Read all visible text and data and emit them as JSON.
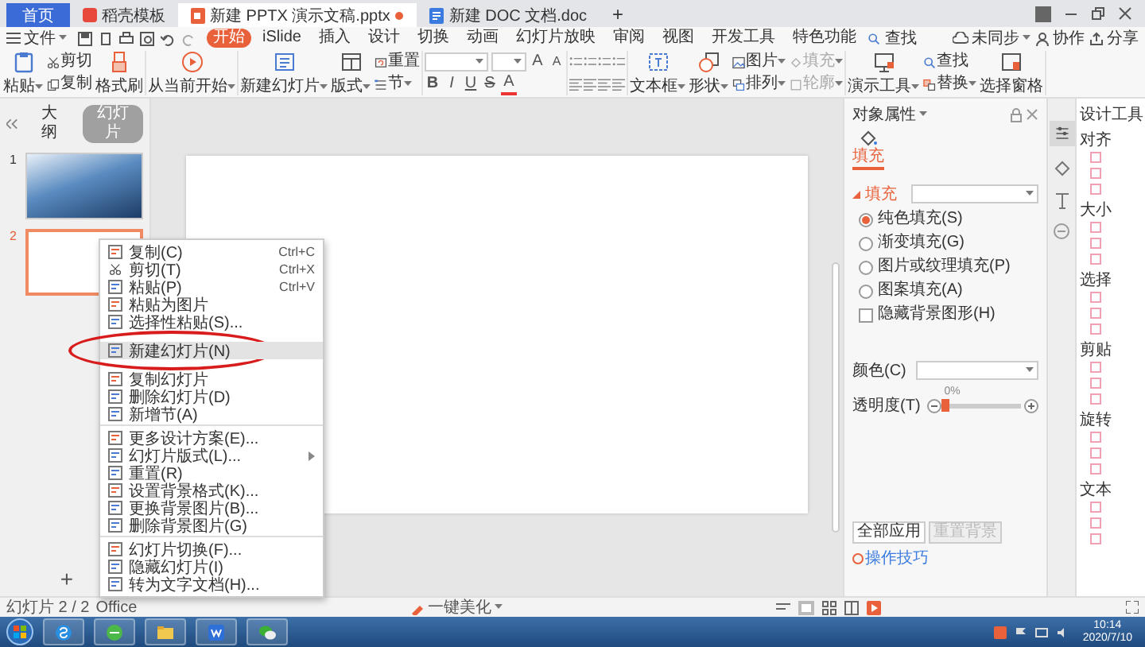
{
  "title_tabs": [
    {
      "label": "首页",
      "kind": "home",
      "selected": false
    },
    {
      "label": "稻壳模板",
      "kind": "docer",
      "selected": false
    },
    {
      "label": "新建 PPTX 演示文稿.pptx",
      "kind": "pptx",
      "selected": true
    },
    {
      "label": "新建 DOC 文档.doc",
      "kind": "doc",
      "selected": false
    }
  ],
  "new_tab": "+",
  "menu": {
    "file": "文件",
    "tabs": [
      {
        "label": "开始",
        "selected": true
      },
      {
        "label": "iSlide",
        "selected": false
      },
      {
        "label": "插入",
        "selected": false
      },
      {
        "label": "设计",
        "selected": false
      },
      {
        "label": "切换",
        "selected": false
      },
      {
        "label": "动画",
        "selected": false
      },
      {
        "label": "幻灯片放映",
        "selected": false
      },
      {
        "label": "审阅",
        "selected": false
      },
      {
        "label": "视图",
        "selected": false
      },
      {
        "label": "开发工具",
        "selected": false
      },
      {
        "label": "特色功能",
        "selected": false
      }
    ],
    "search": "查找",
    "sync": "未同步",
    "collab": "协作",
    "share": "分享"
  },
  "ribbon": {
    "groups": [
      {
        "items": [
          {
            "kind": "big",
            "label": "粘贴",
            "dropdown": true
          },
          {
            "kind": "stack",
            "buttons": [
              {
                "label": "剪切",
                "dropdown": false,
                "disabled": false
              },
              {
                "label": "复制",
                "dropdown": false,
                "disabled": false
              }
            ]
          },
          {
            "kind": "big",
            "label": "格式刷",
            "dropdown": false
          }
        ]
      },
      {
        "items": [
          {
            "kind": "big",
            "label": "从当前开始",
            "dropdown": true
          }
        ]
      },
      {
        "items": [
          {
            "kind": "big",
            "label": "新建幻灯片",
            "dropdown": true
          },
          {
            "kind": "big",
            "label": "版式",
            "dropdown": true
          },
          {
            "kind": "stack",
            "buttons": [
              {
                "label": "重置",
                "dropdown": false,
                "disabled": false
              },
              {
                "label": "节",
                "dropdown": true,
                "disabled": false
              }
            ]
          }
        ]
      },
      {
        "items": [
          {
            "kind": "font",
            "format": [
              "B",
              "I",
              "U",
              "S",
              "A"
            ],
            "sizes": [
              "A",
              "A"
            ]
          }
        ]
      },
      {
        "items": [
          {
            "kind": "paragraph"
          }
        ]
      },
      {
        "items": [
          {
            "kind": "big",
            "label": "文本框",
            "dropdown": true
          },
          {
            "kind": "big",
            "label": "形状",
            "dropdown": true
          },
          {
            "kind": "stack",
            "buttons": [
              {
                "label": "图片",
                "dropdown": true,
                "disabled": false
              },
              {
                "label": "排列",
                "dropdown": true,
                "disabled": false
              }
            ]
          },
          {
            "kind": "stack",
            "buttons": [
              {
                "label": "填充",
                "dropdown": true,
                "disabled": true
              },
              {
                "label": "轮廓",
                "dropdown": true,
                "disabled": true
              }
            ]
          }
        ]
      },
      {
        "items": [
          {
            "kind": "big",
            "label": "演示工具",
            "dropdown": true
          },
          {
            "kind": "stack",
            "buttons": [
              {
                "label": "查找",
                "dropdown": false,
                "disabled": false
              },
              {
                "label": "替换",
                "dropdown": true,
                "disabled": false
              }
            ]
          },
          {
            "kind": "big",
            "label": "选择窗格",
            "dropdown": false
          }
        ]
      }
    ]
  },
  "slides_panel": {
    "tabs": [
      {
        "label": "大纲",
        "selected": false
      },
      {
        "label": "幻灯片",
        "selected": true
      }
    ],
    "slides": [
      {
        "number": "1",
        "kind": "photo",
        "selected": false
      },
      {
        "number": "2",
        "kind": "blank",
        "selected": true
      }
    ],
    "add": "+"
  },
  "context_menu": {
    "items": [
      {
        "label": "复制(C)",
        "shortcut": "Ctrl+C",
        "separator_before": false,
        "submenu": false,
        "selected": false
      },
      {
        "label": "剪切(T)",
        "shortcut": "Ctrl+X",
        "separator_before": false,
        "submenu": false,
        "selected": false
      },
      {
        "label": "粘贴(P)",
        "shortcut": "Ctrl+V",
        "separator_before": false,
        "submenu": false,
        "selected": false
      },
      {
        "label": "粘贴为图片",
        "separator_before": false,
        "submenu": false,
        "selected": false
      },
      {
        "label": "选择性粘贴(S)...",
        "separator_before": false,
        "submenu": false,
        "selected": false
      },
      {
        "label": "新建幻灯片(N)",
        "separator_before": false,
        "submenu": false,
        "selected": true
      },
      {
        "label": "复制幻灯片",
        "separator_before": false,
        "submenu": false,
        "selected": false
      },
      {
        "label": "删除幻灯片(D)",
        "separator_before": false,
        "submenu": false,
        "selected": false
      },
      {
        "label": "新增节(A)",
        "separator_before": false,
        "submenu": false,
        "selected": false
      },
      {
        "label": "更多设计方案(E)...",
        "separator_before": true,
        "submenu": false,
        "selected": false
      },
      {
        "label": "幻灯片版式(L)...",
        "separator_before": false,
        "submenu": true,
        "selected": false
      },
      {
        "label": "重置(R)",
        "separator_before": false,
        "submenu": false,
        "selected": false
      },
      {
        "label": "设置背景格式(K)...",
        "separator_before": false,
        "submenu": false,
        "selected": false
      },
      {
        "label": "更换背景图片(B)...",
        "separator_before": false,
        "submenu": false,
        "selected": false
      },
      {
        "label": "删除背景图片(G)",
        "separator_before": false,
        "submenu": false,
        "selected": false
      },
      {
        "label": "幻灯片切换(F)...",
        "separator_before": true,
        "submenu": false,
        "selected": false
      },
      {
        "label": "隐藏幻灯片(I)",
        "separator_before": false,
        "submenu": false,
        "selected": false
      },
      {
        "label": "转为文字文档(H)...",
        "separator_before": false,
        "submenu": false,
        "selected": false
      }
    ]
  },
  "properties_panel": {
    "title": "对象属性",
    "tab": "填充",
    "section": "填充",
    "fill_options": [
      {
        "label": "纯色填充(S)",
        "selected": true
      },
      {
        "label": "渐变填充(G)",
        "selected": false
      },
      {
        "label": "图片或纹理填充(P)",
        "selected": false
      },
      {
        "label": "图案填充(A)",
        "selected": false
      }
    ],
    "hide_background": {
      "label": "隐藏背景图形(H)",
      "checked": false
    },
    "color_label": "颜色(C)",
    "transparency": {
      "label": "透明度(T)",
      "reading": "0%",
      "level": 0
    },
    "buttons": [
      {
        "label": "全部应用",
        "disabled": false
      },
      {
        "label": "重置背景",
        "disabled": true
      }
    ],
    "tips": "操作技巧"
  },
  "design_tools": {
    "title": "设计工具",
    "sections": [
      "对齐",
      "大小",
      "选择",
      "剪贴",
      "旋转",
      "文本"
    ]
  },
  "status_bar": {
    "slide": "幻灯片 2 / 2",
    "theme": "Office",
    "beautify": "一键美化"
  },
  "taskbar": {
    "time": "10:14",
    "date": "2020/7/10"
  }
}
